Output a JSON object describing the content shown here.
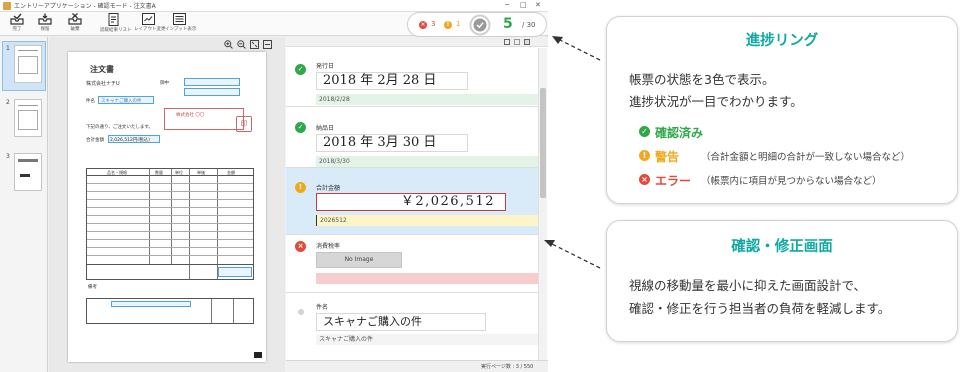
{
  "app": {
    "title": "エントリーアプリケーション - 確認モード - 注文書A",
    "window_buttons": [
      "─",
      "□",
      "✕"
    ]
  },
  "toolbar": {
    "buttons": [
      {
        "label": "完了",
        "icon": "inbox-complete-icon"
      },
      {
        "label": "保留",
        "icon": "inbox-hold-icon"
      },
      {
        "label": "破棄",
        "icon": "inbox-discard-icon"
      },
      {
        "label": "読取結果リスト",
        "icon": "result-list-icon"
      },
      {
        "label": "レイアウト変更",
        "icon": "layout-change-icon"
      },
      {
        "label": "インプット表示",
        "icon": "input-display-icon"
      }
    ]
  },
  "status": {
    "error_count": "3",
    "warning_count": "1",
    "done_count": "5",
    "total": "/ 30",
    "colors": {
      "error": "#e04b3b",
      "warning": "#f2a81d",
      "ok": "#2ea84a"
    }
  },
  "thumbnails": [
    {
      "page": "1",
      "selected": true
    },
    {
      "page": "2",
      "selected": false
    },
    {
      "page": "3",
      "selected": false
    }
  ],
  "document": {
    "title": "注文書",
    "to": "株式会社ナチU",
    "honorific": "御中",
    "subject_label": "件名",
    "subject": "スキャナご購入の件",
    "note": "下記の通り、ご注文いたします。",
    "total_label": "合計金額",
    "total_value": "2,026,512円(税込)",
    "issuer": "株式会社 〇〇",
    "seal": "印",
    "table_headers": [
      "品名・規格",
      "数量",
      "単位",
      "単価",
      "金額"
    ],
    "remarks_label": "備考"
  },
  "fields": [
    {
      "label": "発行日",
      "image_text": "2018 年 2月 28 日",
      "value": "2018/2/28",
      "status": "ok"
    },
    {
      "label": "納品日",
      "image_text": "2018 年 3月 30 日",
      "value": "2018/3/30",
      "status": "ok"
    },
    {
      "label": "合計金額",
      "image_text": "￥2,026,512",
      "value": "2026512",
      "status": "warning"
    },
    {
      "label": "消費税率",
      "image_text": "No Image",
      "value": "",
      "status": "error"
    },
    {
      "label": "件名",
      "image_text": "スキャナご購入の件",
      "value": "スキャナご購入の件",
      "status": "none"
    }
  ],
  "statusbar": {
    "text": "実行ページ数 :   3 / 550"
  },
  "callouts": {
    "progress": {
      "title": "進捗リング",
      "lines": [
        "帳票の状態を3色で表示。",
        "進捗状況が一目でわかります。"
      ],
      "legend": [
        {
          "name": "確認済み",
          "note": "",
          "color": "#2ea84a",
          "icon": "check-icon"
        },
        {
          "name": "警告",
          "note": "（合計金額と明細の合計が一致しない場合など）",
          "color": "#f2a81d",
          "icon": "warning-icon"
        },
        {
          "name": "エラー",
          "note": "（帳票内に項目が見つからない場合など）",
          "color": "#e04b3b",
          "icon": "error-icon"
        }
      ]
    },
    "review": {
      "title": "確認・修正画面",
      "lines": [
        "視線の移動量を最小に抑えた画面設計で、",
        "確認・修正を行う担当者の負荷を軽減します。"
      ]
    }
  }
}
